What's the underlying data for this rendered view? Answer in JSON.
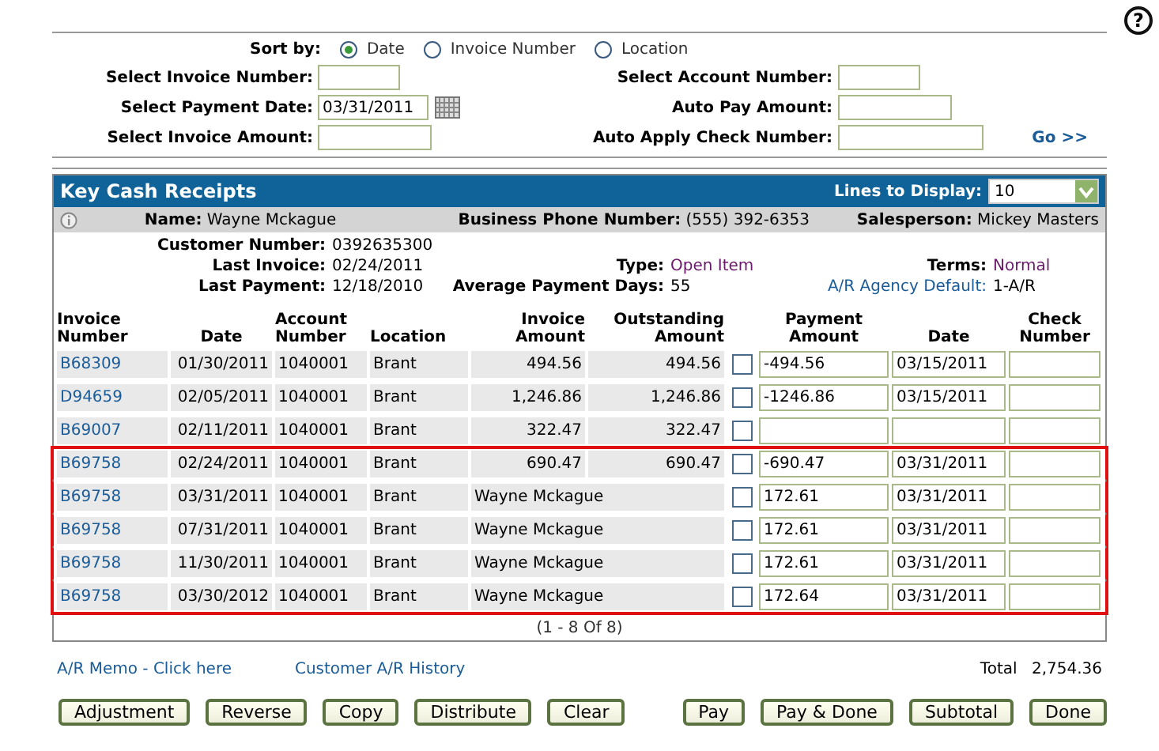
{
  "help": {
    "label": "?"
  },
  "sort": {
    "label": "Sort by:",
    "options": [
      {
        "label": "Date",
        "selected": true
      },
      {
        "label": "Invoice Number",
        "selected": false
      },
      {
        "label": "Location",
        "selected": false
      }
    ]
  },
  "filters_left": [
    {
      "label": "Select Invoice Number:",
      "kind": "short"
    },
    {
      "label": "Select Payment Date:",
      "value": "03/31/2011",
      "kind": "date"
    },
    {
      "label": "Select Invoice Amount:",
      "kind": "long"
    }
  ],
  "filters_right": [
    {
      "label": "Select Account Number:",
      "kind": "short"
    },
    {
      "label": "Auto Pay Amount:",
      "kind": "long"
    },
    {
      "label": "Auto Apply Check Number:",
      "kind": "wide"
    }
  ],
  "go": "Go >>",
  "panel": {
    "title": "Key Cash Receipts",
    "lines_label": "Lines to Display:",
    "lines_value": "10"
  },
  "customer": {
    "name_label": "Name:",
    "name": "Wayne Mckague",
    "phone_label": "Business Phone Number:",
    "phone": "(555) 392-6353",
    "sales_label": "Salesperson:",
    "sales": "Mickey Masters"
  },
  "details": {
    "number_label": "Customer Number:",
    "number": "0392635300",
    "last_invoice_label": "Last Invoice:",
    "last_invoice": "02/24/2011",
    "type_label": "Type:",
    "type": "Open Item",
    "terms_label": "Terms:",
    "terms": "Normal",
    "last_payment_label": "Last Payment:",
    "last_payment": "12/18/2010",
    "avg_label": "Average Payment Days:",
    "avg": "55",
    "agency_label": "A/R Agency Default:",
    "agency": "1-A/R"
  },
  "columns": [
    "Invoice Number",
    "Date",
    "Account Number",
    "Location",
    "Invoice Amount",
    "Outstanding Amount",
    "Payment Amount",
    "Date",
    "Check Number"
  ],
  "rows": [
    {
      "kind": "invoice",
      "invoice": "B68309",
      "date": "01/30/2011",
      "account": "1040001",
      "location": "Brant",
      "amount": "494.56",
      "outstanding": "494.56",
      "checked": false,
      "payment": "-494.56",
      "pay_date": "03/15/2011",
      "highlighted": false
    },
    {
      "kind": "invoice",
      "invoice": "D94659",
      "date": "02/05/2011",
      "account": "1040001",
      "location": "Brant",
      "amount": "1,246.86",
      "outstanding": "1,246.86",
      "checked": false,
      "payment": "-1246.86",
      "pay_date": "03/15/2011",
      "highlighted": false
    },
    {
      "kind": "invoice",
      "invoice": "B69007",
      "date": "02/11/2011",
      "account": "1040001",
      "location": "Brant",
      "amount": "322.47",
      "outstanding": "322.47",
      "checked": false,
      "highlighted": false
    },
    {
      "kind": "invoice",
      "invoice": "B69758",
      "date": "02/24/2011",
      "account": "1040001",
      "location": "Brant",
      "amount": "690.47",
      "outstanding": "690.47",
      "checked": false,
      "payment": "-690.47",
      "pay_date": "03/31/2011",
      "highlighted": true
    },
    {
      "kind": "schedule",
      "invoice": "B69758",
      "date": "03/31/2011",
      "account": "1040001",
      "location": "Brant",
      "customer": "Wayne Mckague",
      "checked": false,
      "payment": "172.61",
      "pay_date": "03/31/2011",
      "highlighted": true
    },
    {
      "kind": "schedule",
      "invoice": "B69758",
      "date": "07/31/2011",
      "account": "1040001",
      "location": "Brant",
      "customer": "Wayne Mckague",
      "checked": false,
      "payment": "172.61",
      "pay_date": "03/31/2011",
      "highlighted": true
    },
    {
      "kind": "schedule",
      "invoice": "B69758",
      "date": "11/30/2011",
      "account": "1040001",
      "location": "Brant",
      "customer": "Wayne Mckague",
      "checked": false,
      "payment": "172.61",
      "pay_date": "03/31/2011",
      "highlighted": true
    },
    {
      "kind": "schedule",
      "invoice": "B69758",
      "date": "03/30/2012",
      "account": "1040001",
      "location": "Brant",
      "customer": "Wayne Mckague",
      "checked": false,
      "payment": "172.64",
      "pay_date": "03/31/2011",
      "highlighted": true
    }
  ],
  "pagination": "(1 - 8 Of 8)",
  "links": [
    "A/R Memo - Click here",
    "Customer A/R History"
  ],
  "total": {
    "label": "Total",
    "value": "2,754.36"
  },
  "buttons_left": [
    "Adjustment",
    "Reverse",
    "Copy",
    "Distribute",
    "Clear"
  ],
  "buttons_right": [
    "Pay",
    "Pay & Done",
    "Subtotal",
    "Done"
  ]
}
